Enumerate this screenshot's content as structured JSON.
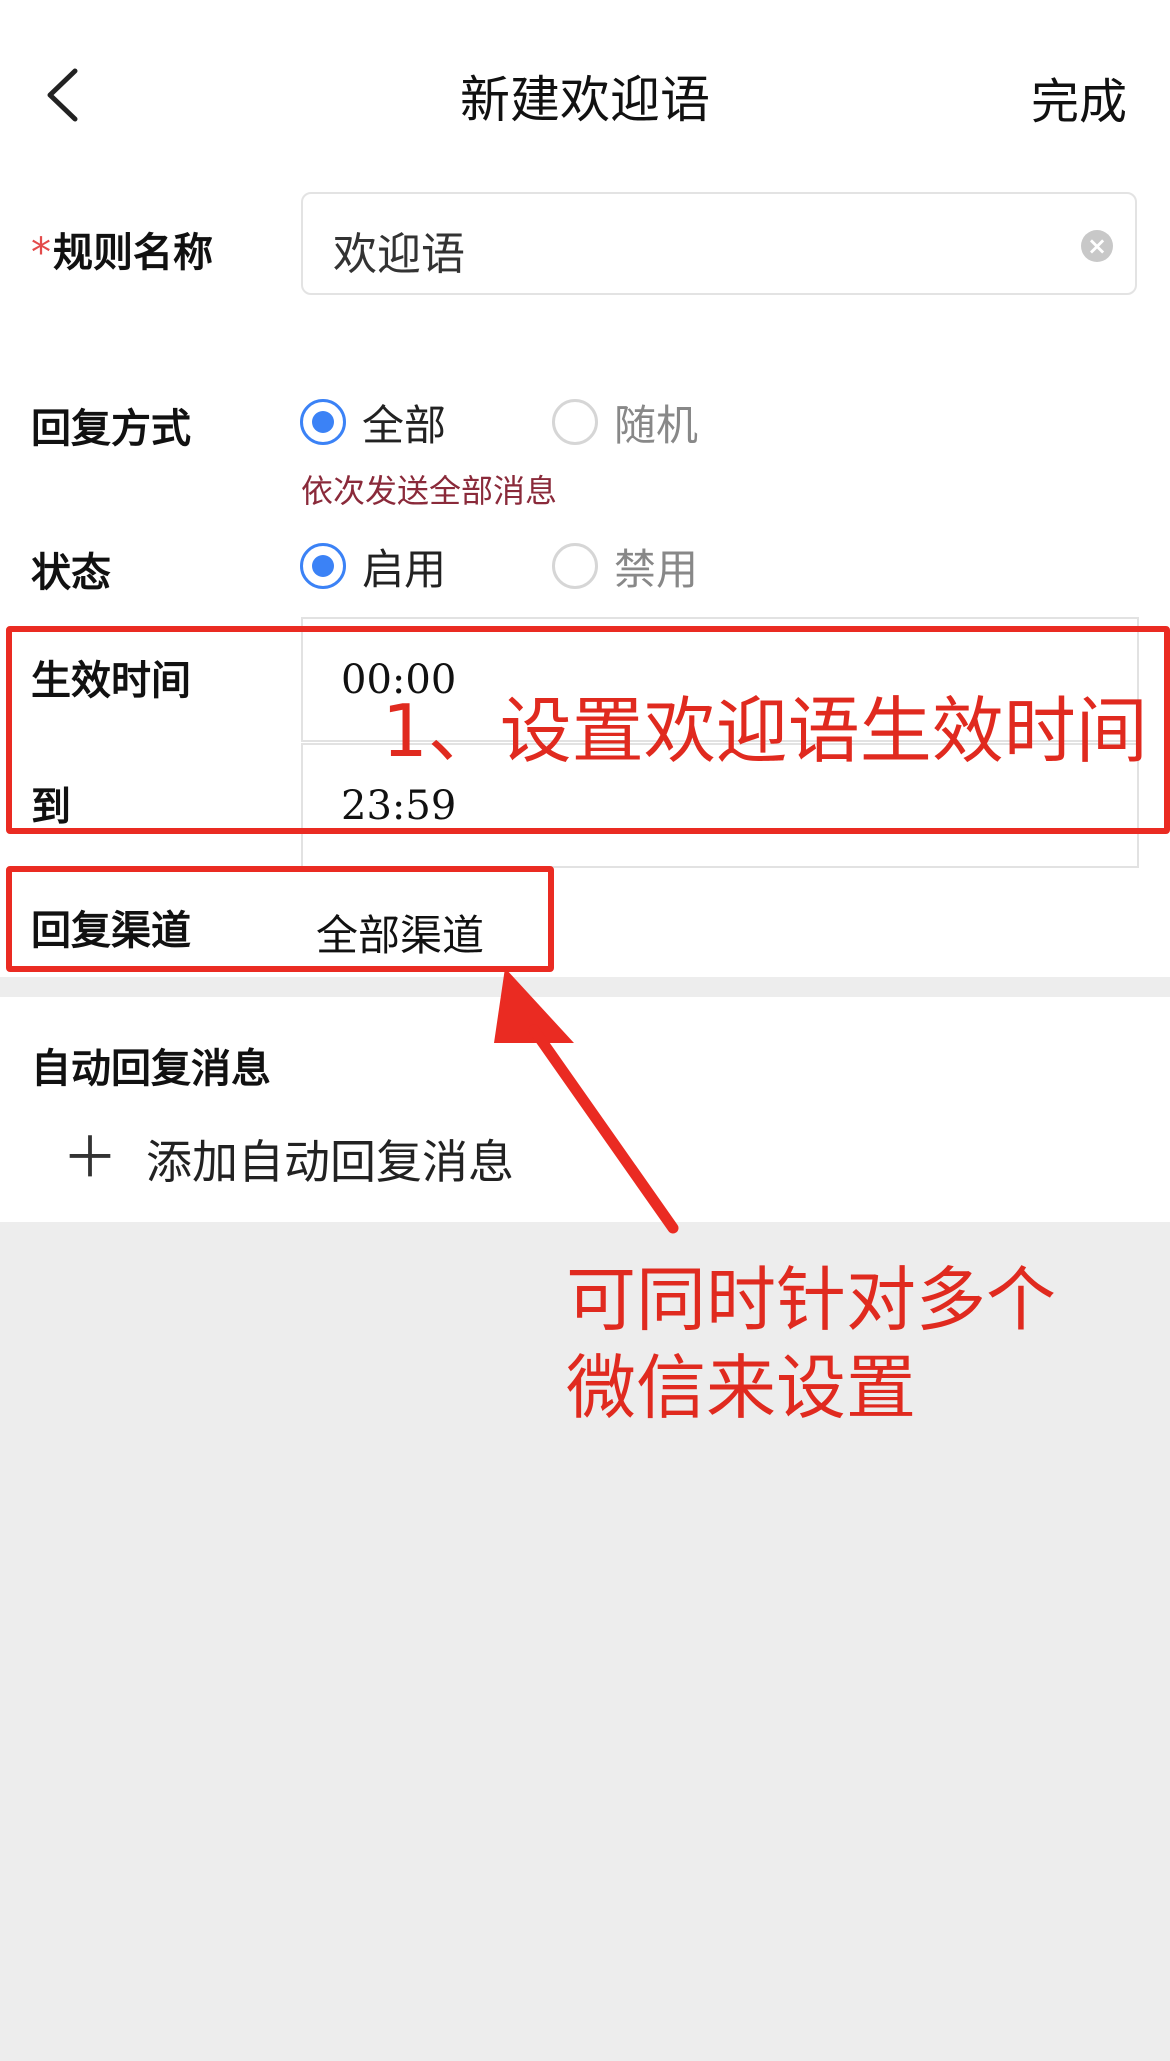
{
  "header": {
    "back_icon": "chevron-left-icon",
    "title": "新建欢迎语",
    "done_label": "完成"
  },
  "form": {
    "rule_name": {
      "required_mark": "*",
      "label": "规则名称",
      "value": "欢迎语",
      "clear_icon": "clear-circle-icon"
    },
    "reply_mode": {
      "label": "回复方式",
      "options": [
        {
          "label": "全部",
          "selected": true
        },
        {
          "label": "随机",
          "selected": false
        }
      ],
      "hint": "依次发送全部消息"
    },
    "status": {
      "label": "状态",
      "options": [
        {
          "label": "启用",
          "selected": true
        },
        {
          "label": "禁用",
          "selected": false
        }
      ]
    },
    "effective_time": {
      "label": "生效时间",
      "start": "00:00",
      "to_label": "到",
      "end": "23:59"
    },
    "channel": {
      "label": "回复渠道",
      "value": "全部渠道"
    }
  },
  "auto_reply": {
    "title": "自动回复消息",
    "add_icon": "plus-icon",
    "add_label": "添加自动回复消息"
  },
  "annotations": {
    "note_1": "1、设置欢迎语生效时间",
    "note_2_line1": "可同时针对多个",
    "note_2_line2": "微信来设置",
    "color": "#e02a1f"
  },
  "colors": {
    "accent": "#3b82f6",
    "hint": "#8a2a3a",
    "background": "#ededed"
  }
}
